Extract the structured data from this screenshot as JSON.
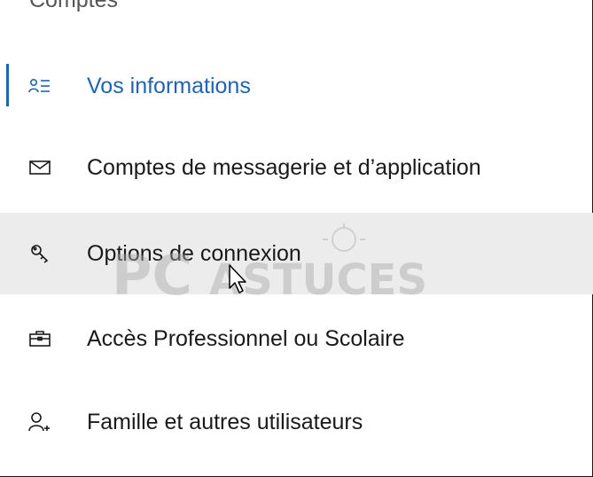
{
  "section": {
    "title": "Comptes"
  },
  "nav": {
    "items": [
      {
        "label": "Vos informations",
        "icon": "person-list-icon"
      },
      {
        "label": "Comptes de messagerie et d’application",
        "icon": "mail-icon"
      },
      {
        "label": "Options de connexion",
        "icon": "key-icon"
      },
      {
        "label": "Accès Professionnel ou Scolaire",
        "icon": "briefcase-icon"
      },
      {
        "label": "Famille et autres utilisateurs",
        "icon": "add-person-icon"
      }
    ],
    "selected_index": 0,
    "hover_index": 2
  },
  "watermark": {
    "text": "PCASTUCES"
  },
  "colors": {
    "accent": "#1f63b4",
    "hover_bg": "#ececec",
    "text": "#1a1a1a"
  }
}
